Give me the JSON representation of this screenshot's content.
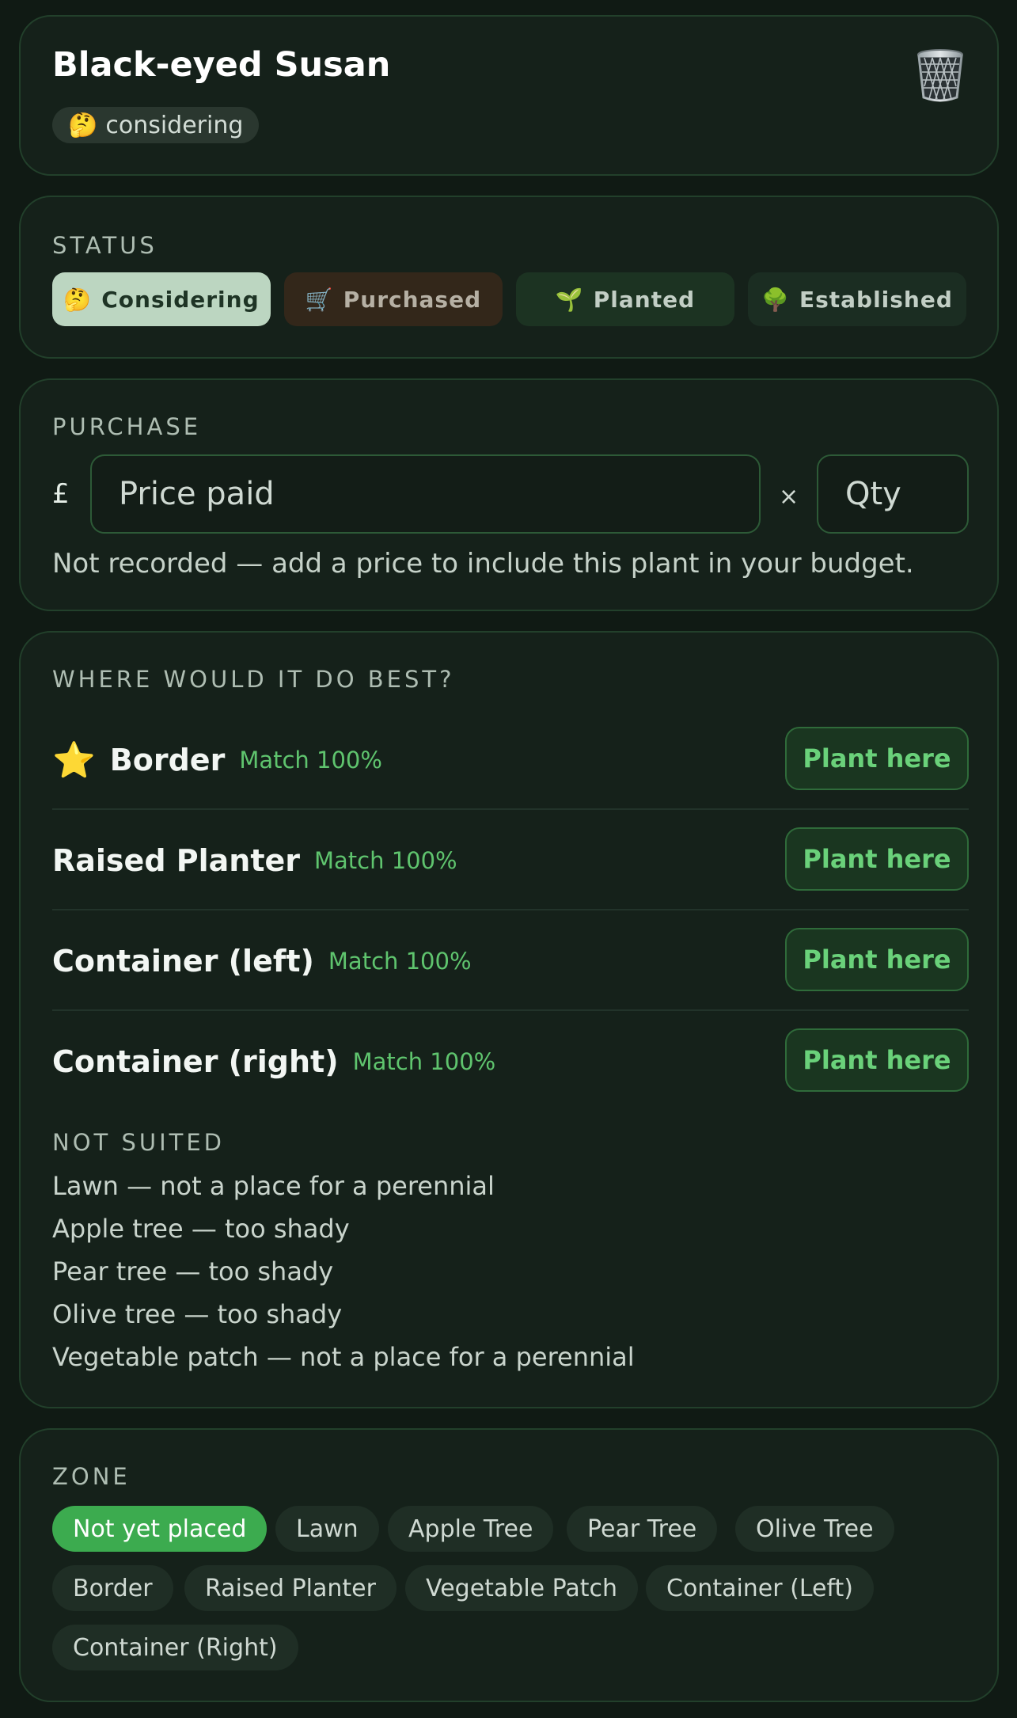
{
  "header": {
    "title": "Black-eyed Susan",
    "status_pill": {
      "emoji": "🤔",
      "label": "considering"
    },
    "trash_icon": "trash-icon"
  },
  "status": {
    "label": "STATUS",
    "options": [
      {
        "emoji": "🤔",
        "label": "Considering",
        "selected": true
      },
      {
        "emoji": "🛒",
        "label": "Purchased",
        "selected": false
      },
      {
        "emoji": "🌱",
        "label": "Planted",
        "selected": false
      },
      {
        "emoji": "🌳",
        "label": "Established",
        "selected": false
      }
    ]
  },
  "purchase": {
    "label": "PURCHASE",
    "currency": "£",
    "price_value": "",
    "price_placeholder": "Price paid",
    "times": "×",
    "qty_value": "",
    "qty_placeholder": "Qty",
    "note": "Not recorded — add a price to include this plant in your budget."
  },
  "where": {
    "label": "WHERE WOULD IT DO BEST?",
    "best": [
      {
        "name": "Border",
        "match": "Match 100%",
        "button": "Plant here",
        "starred": true,
        "star": "⭐"
      },
      {
        "name": "Raised Planter",
        "match": "Match 100%",
        "button": "Plant here",
        "starred": false
      },
      {
        "name": "Container (left)",
        "match": "Match 100%",
        "button": "Plant here",
        "starred": false
      },
      {
        "name": "Container (right)",
        "match": "Match 100%",
        "button": "Plant here",
        "starred": false
      }
    ],
    "not_suited_label": "NOT SUITED",
    "not_suited": [
      "Lawn — not a place for a perennial",
      "Apple tree — too shady",
      "Pear tree — too shady",
      "Olive tree — too shady",
      "Vegetable patch — not a place for a perennial"
    ]
  },
  "zone": {
    "label": "ZONE",
    "chips": [
      {
        "label": "Not yet placed",
        "active": true
      },
      {
        "label": "Lawn",
        "active": false
      },
      {
        "label": "Apple Tree",
        "active": false
      },
      {
        "label": "Pear Tree",
        "active": false
      },
      {
        "label": "Olive Tree",
        "active": false
      },
      {
        "label": "Border",
        "active": false
      },
      {
        "label": "Raised Planter",
        "active": false
      },
      {
        "label": "Vegetable Patch",
        "active": false
      },
      {
        "label": "Container (Left)",
        "active": false
      },
      {
        "label": "Container (Right)",
        "active": false
      }
    ]
  },
  "colors": {
    "background": "#101a14",
    "card": "#15211a",
    "accent": "#3cab4f",
    "match_text": "#5fc46e"
  }
}
